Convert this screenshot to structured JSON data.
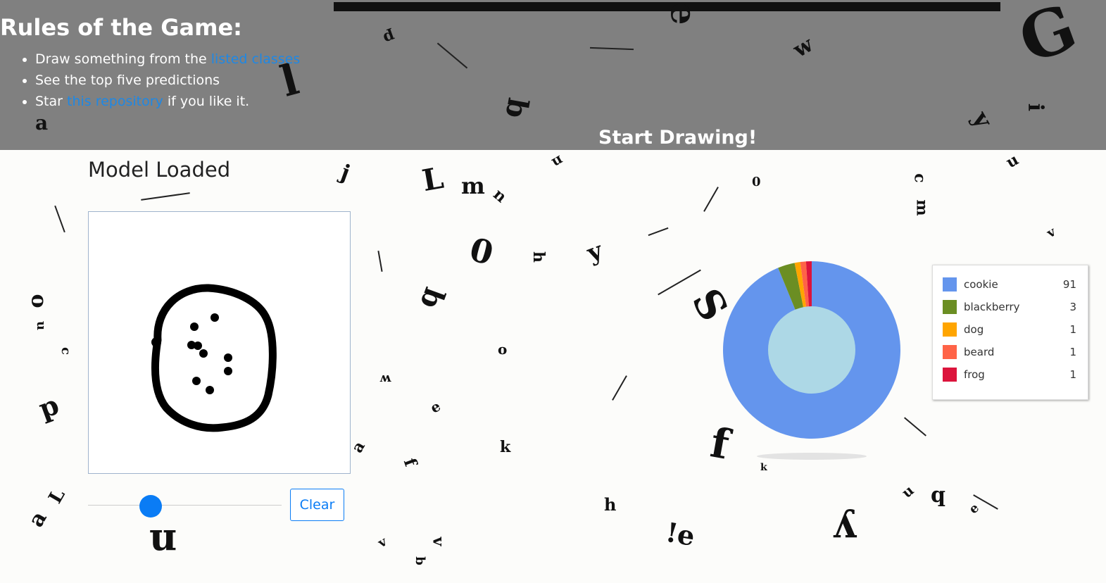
{
  "header": {
    "rules_title": "Rules of the Game:",
    "rule1_prefix": "Draw something from the ",
    "rule1_link": "listed classes",
    "rule2": "See the top five predictions",
    "rule3_prefix": "Star ",
    "rule3_link": "this repository",
    "rule3_suffix": " if you like it.",
    "start_label": "Start Drawing!"
  },
  "main": {
    "status": "Model Loaded",
    "clear_label": "Clear",
    "brush_size": 0.3
  },
  "colors": {
    "header_bg": "#808080",
    "link": "#1e88e5",
    "accent": "#0a7cf5",
    "donut_hole": "#add8e6"
  },
  "chart_data": {
    "type": "pie",
    "donut": true,
    "categories": [
      "cookie",
      "blackberry",
      "dog",
      "beard",
      "frog"
    ],
    "values": [
      91,
      3,
      1,
      1,
      1
    ],
    "colors": [
      "#6495ed",
      "#6b8e23",
      "#ffa500",
      "#ff6347",
      "#dc143c"
    ],
    "legend_position": "right"
  }
}
